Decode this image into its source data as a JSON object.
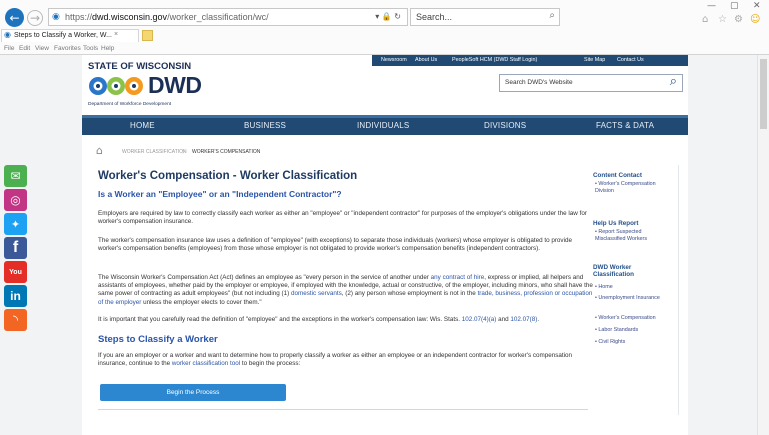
{
  "browser": {
    "url_prefix": "https://",
    "url_domain": "dwd.wisconsin.gov",
    "url_path": "/worker_classification/wc/",
    "addr_icons": "▾ 🔒 ↻",
    "search_placeholder": "Search...",
    "tab_title": "Steps to Classify a Worker, W...",
    "menu": [
      "File",
      "Edit",
      "View",
      "Favorites",
      "Tools",
      "Help"
    ],
    "win_controls": [
      "—",
      "▢",
      "✕"
    ]
  },
  "header": {
    "state": "STATE OF WISCONSIN",
    "logo_text": "DWD",
    "dept": "Department of Workforce Development",
    "links": [
      "Newsroom",
      "About Us",
      "PeopleSoft HCM (DWD Staff Login)",
      "Site Map",
      "Contact Us"
    ],
    "search_placeholder": "Search DWD's Website"
  },
  "nav": [
    "HOME",
    "BUSINESS",
    "INDIVIDUALS",
    "DIVISIONS",
    "FACTS & DATA"
  ],
  "breadcrumb": [
    "WORKER CLASSIFICATION",
    "WORKER'S COMPENSATION"
  ],
  "article": {
    "title": "Worker's Compensation - Worker Classification",
    "question": "Is a Worker an \"Employee\" or an \"Independent Contractor\"?",
    "p1": "Employers are required by law to correctly classify each worker as either an \"employee\" or \"independent contractor\" for purposes of the employer's obligations under the law for worker's compensation insurance.",
    "p2": "The worker's compensation insurance law uses a definition of \"employee\" (with exceptions) to separate those individuals (workers) whose employer is obligated to provide worker's compensation benefits (employees) from those whose employer is not obligated to provide worker's compensation benefits (independent contractors).",
    "p3_a": "The Wisconsin Worker's Compensation Act (Act) defines an employee as \"every person in the service of another under ",
    "p3_link1": "any contract of hire",
    "p3_b": ", express or implied, all helpers and assistants of employees, whether paid by the employer or employee, if employed with the knowledge, actual or constructive, of the employer, including minors, who shall have the same power of contracting as adult employees\" (but not including (1) ",
    "p3_link2": "domestic servants",
    "p3_c": ", (2) any person whose employment is not in the ",
    "p3_link3": "trade, business, profession or occupation of the employer",
    "p3_d": " unless the employer elects to cover them.\"",
    "p4_a": "It is important that you carefully read the definition of \"employee\" and the exceptions in the worker's compensation law: Wis. Stats. ",
    "p4_link1": "102.07(4)(a)",
    "p4_b": " and ",
    "p4_link2": "102.07(8)",
    "p4_c": ".",
    "steps_title": "Steps to Classify a Worker",
    "p5_a": "If you are an employer or a worker and want to determine how to properly classify a worker as either an employee or an independent contractor for worker's compensation insurance, continue to the ",
    "p5_link": "worker classification tool",
    "p5_b": " to begin the process:",
    "button": "Begin the Process"
  },
  "sidebar": {
    "contact_title": "Content Contact",
    "contact_items": [
      "Worker's Compensation Division"
    ],
    "help_title": "Help Us Report",
    "help_items": [
      "Report Suspected Misclassified Workers"
    ],
    "dwd_title": "DWD Worker Classification",
    "dwd_items": [
      "Home",
      "Unemployment Insurance",
      "Worker's Compensation",
      "Labor Standards",
      "Civil Rights"
    ]
  },
  "social": [
    {
      "icon": "email-icon",
      "color": "#4caf50",
      "glyph": "✉"
    },
    {
      "icon": "instagram-icon",
      "color": "#c13584",
      "glyph": "◎"
    },
    {
      "icon": "twitter-icon",
      "color": "#1da1f2",
      "glyph": "🐦"
    },
    {
      "icon": "facebook-icon",
      "color": "#3b5998",
      "glyph": "f"
    },
    {
      "icon": "youtube-icon",
      "color": "#e52d27",
      "glyph": "You"
    },
    {
      "icon": "linkedin-icon",
      "color": "#0077b5",
      "glyph": "in"
    },
    {
      "icon": "rss-icon",
      "color": "#f26522",
      "glyph": "◝"
    }
  ],
  "colors": {
    "nav": "#204a73",
    "accent": "#2c87d0",
    "title": "#1f3a63",
    "link": "#2a55a8"
  }
}
